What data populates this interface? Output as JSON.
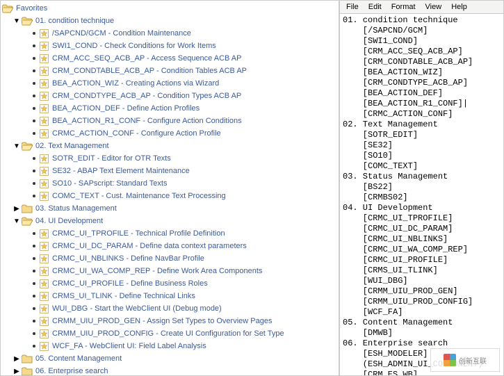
{
  "favorites_label": "Favorites",
  "menu": {
    "file": "File",
    "edit": "Edit",
    "format": "Format",
    "view": "View",
    "help": "Help"
  },
  "watermark": "创新互联",
  "tree": [
    {
      "type": "folder",
      "state": "open",
      "indent": 1,
      "label": "01. condition technique"
    },
    {
      "type": "item",
      "indent": 2,
      "label": "/SAPCND/GCM - Condition Maintenance"
    },
    {
      "type": "item",
      "indent": 2,
      "label": "SWI1_COND - Check Conditions for Work Items"
    },
    {
      "type": "item",
      "indent": 2,
      "label": "CRM_ACC_SEQ_ACB_AP - Access Sequence ACB AP"
    },
    {
      "type": "item",
      "indent": 2,
      "label": "CRM_CONDTABLE_ACB_AP - Condition Tables ACB AP"
    },
    {
      "type": "item",
      "indent": 2,
      "label": "BEA_ACTION_WIZ - Creating Actions via Wizard"
    },
    {
      "type": "item",
      "indent": 2,
      "label": "CRM_CONDTYPE_ACB_AP - Condition Types ACB AP"
    },
    {
      "type": "item",
      "indent": 2,
      "label": "BEA_ACTION_DEF - Define Action Profiles"
    },
    {
      "type": "item",
      "indent": 2,
      "label": "BEA_ACTION_R1_CONF - Configure Action Conditions"
    },
    {
      "type": "item",
      "indent": 2,
      "label": "CRMC_ACTION_CONF - Configure Action Profile"
    },
    {
      "type": "folder",
      "state": "open",
      "indent": 1,
      "label": "02. Text Management"
    },
    {
      "type": "item",
      "indent": 2,
      "label": "SOTR_EDIT - Editor for OTR Texts"
    },
    {
      "type": "item",
      "indent": 2,
      "label": "SE32 - ABAP Text Element Maintenance"
    },
    {
      "type": "item",
      "indent": 2,
      "label": "SO10 - SAPscript: Standard Texts"
    },
    {
      "type": "item",
      "indent": 2,
      "label": "COMC_TEXT - Cust. Maintenance Text Processing"
    },
    {
      "type": "folder",
      "state": "closed",
      "indent": 1,
      "label": "03. Status Management"
    },
    {
      "type": "folder",
      "state": "open",
      "indent": 1,
      "label": "04. UI Development"
    },
    {
      "type": "item",
      "indent": 2,
      "label": "CRMC_UI_TPROFILE - Technical Profile Definition"
    },
    {
      "type": "item",
      "indent": 2,
      "label": "CRMC_UI_DC_PARAM - Define data context parameters"
    },
    {
      "type": "item",
      "indent": 2,
      "label": "CRMC_UI_NBLINKS - Define NavBar Profile"
    },
    {
      "type": "item",
      "indent": 2,
      "label": "CRMC_UI_WA_COMP_REP - Define Work Area Components"
    },
    {
      "type": "item",
      "indent": 2,
      "label": "CRMC_UI_PROFILE - Define Business Roles"
    },
    {
      "type": "item",
      "indent": 2,
      "label": "CRMS_UI_TLINK - Define Technical Links"
    },
    {
      "type": "item",
      "indent": 2,
      "label": "WUI_DBG - Start  the WebClient UI (Debug mode)"
    },
    {
      "type": "item",
      "indent": 2,
      "label": "CRMM_UIU_PROD_GEN - Assign Set Types to Overview Pages"
    },
    {
      "type": "item",
      "indent": 2,
      "label": "CRMM_UIU_PROD_CONFIG - Create UI Configuration for Set Type"
    },
    {
      "type": "item",
      "indent": 2,
      "label": "WCF_FA - WebClient UI: Field  Label Analysis"
    },
    {
      "type": "folder",
      "state": "closed",
      "indent": 1,
      "label": "05. Content Management"
    },
    {
      "type": "folder",
      "state": "closed",
      "indent": 1,
      "label": "06. Enterprise search"
    }
  ],
  "textarea": "01. condition technique\n    [/SAPCND/GCM]\n    [SWI1_COND]\n    [CRM_ACC_SEQ_ACB_AP]\n    [CRM_CONDTABLE_ACB_AP]\n    [BEA_ACTION_WIZ]\n    [CRM_CONDTYPE_ACB_AP]\n    [BEA_ACTION_DEF]\n    [BEA_ACTION_R1_CONF]|\n    [CRMC_ACTION_CONF]\n02. Text Management\n    [SOTR_EDIT]\n    [SE32]\n    [SO10]\n    [COMC_TEXT]\n03. Status Management\n    [BS22]\n    [CRMBS02]\n04. UI Development\n    [CRMC_UI_TPROFILE]\n    [CRMC_UI_DC_PARAM]\n    [CRMC_UI_NBLINKS]\n    [CRMC_UI_WA_COMP_REP]\n    [CRMC_UI_PROFILE]\n    [CRMS_UI_TLINK]\n    [WUI_DBG]\n    [CRMM_UIU_PROD_GEN]\n    [CRMM_UIU_PROD_CONFIG]\n    [WCF_FA]\n05. Content Management\n    [DMWB]\n06. Enterprise search\n    [ESH_MODELER]\n    (ESH_ADMIN_UI_COMPONENT)\n    [CRM_ES_WB]\n    [ESH_QUERY_LOG]\n    [ESH_QL"
}
